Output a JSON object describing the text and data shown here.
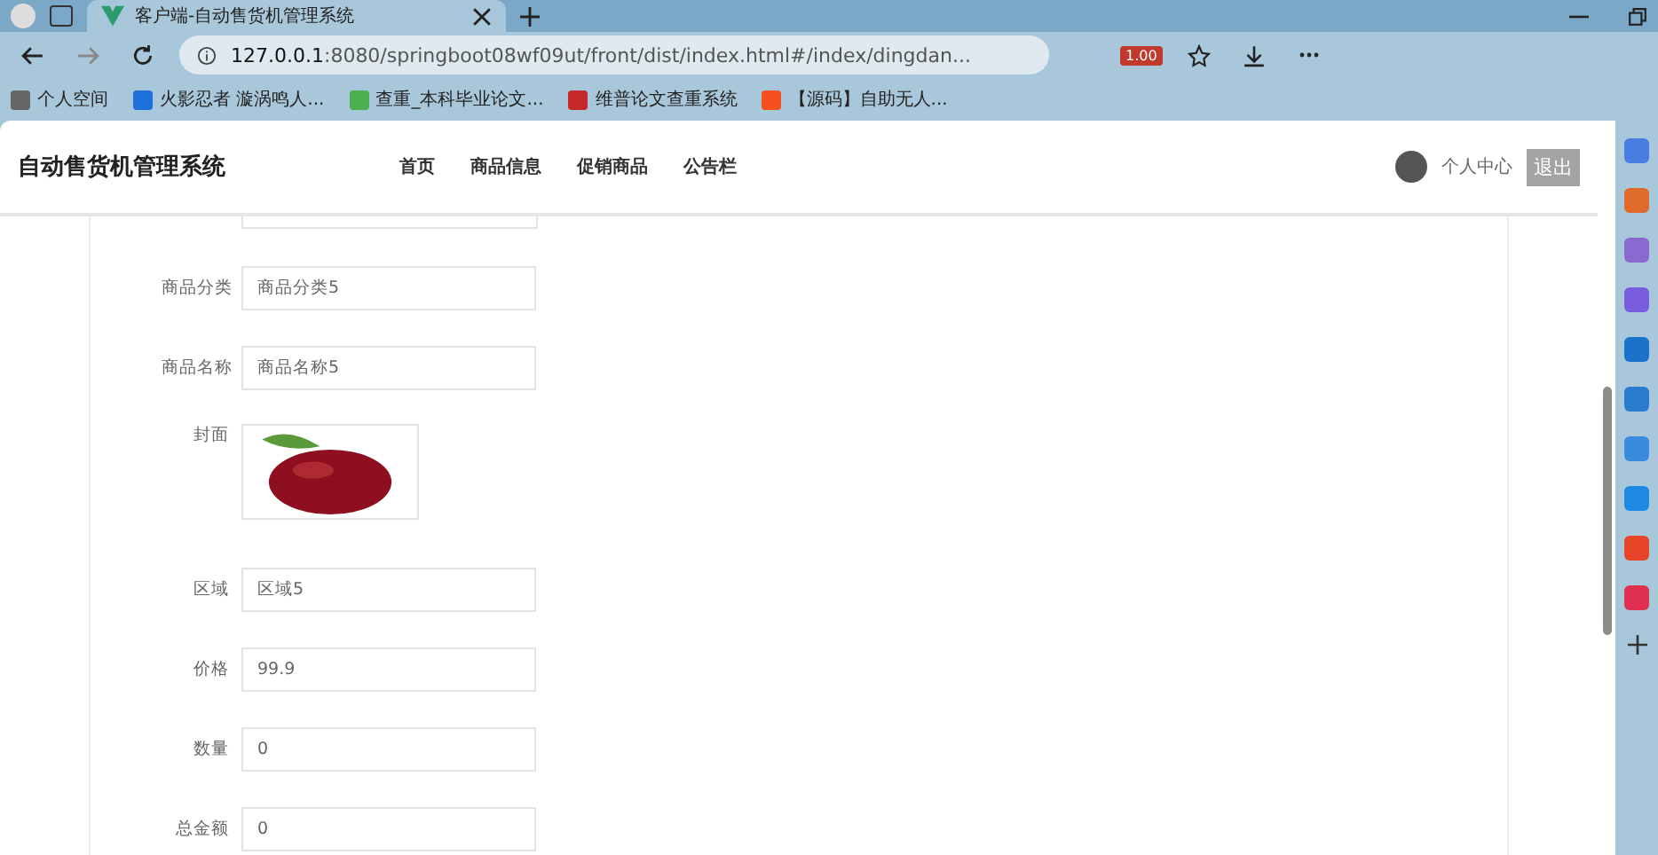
{
  "browser": {
    "tab_title": "客户端-自动售货机管理系统",
    "url_host": "127.0.0.1",
    "url_rest": ":8080/springboot08wf09ut/front/dist/index.html#/index/dingdan...",
    "zoom_badge": "1.00",
    "bookmarks": [
      {
        "label": "个人空间",
        "color": "#666666"
      },
      {
        "label": "火影忍者 漩涡鸣人...",
        "color": "#1e6fd9"
      },
      {
        "label": "查重_本科毕业论文...",
        "color": "#4caf50"
      },
      {
        "label": "维普论文查重系统",
        "color": "#c62828"
      },
      {
        "label": "【源码】自助无人...",
        "color": "#f4511e"
      }
    ]
  },
  "header": {
    "brand": "自动售货机管理系统",
    "nav": [
      {
        "label": "首页"
      },
      {
        "label": "商品信息"
      },
      {
        "label": "促销商品"
      },
      {
        "label": "公告栏"
      }
    ],
    "user_link": "个人中心",
    "logout": "退出"
  },
  "form": [
    {
      "kind": "text",
      "label": "商品分类",
      "value": "商品分类5"
    },
    {
      "kind": "text",
      "label": "商品名称",
      "value": "商品名称5"
    },
    {
      "kind": "image",
      "label": "封面"
    },
    {
      "kind": "text",
      "label": "区域",
      "value": "区域5"
    },
    {
      "kind": "text",
      "label": "价格",
      "value": "99.9"
    },
    {
      "kind": "text",
      "label": "数量",
      "value": "0"
    },
    {
      "kind": "text",
      "label": "总金额",
      "value": "0"
    }
  ]
}
